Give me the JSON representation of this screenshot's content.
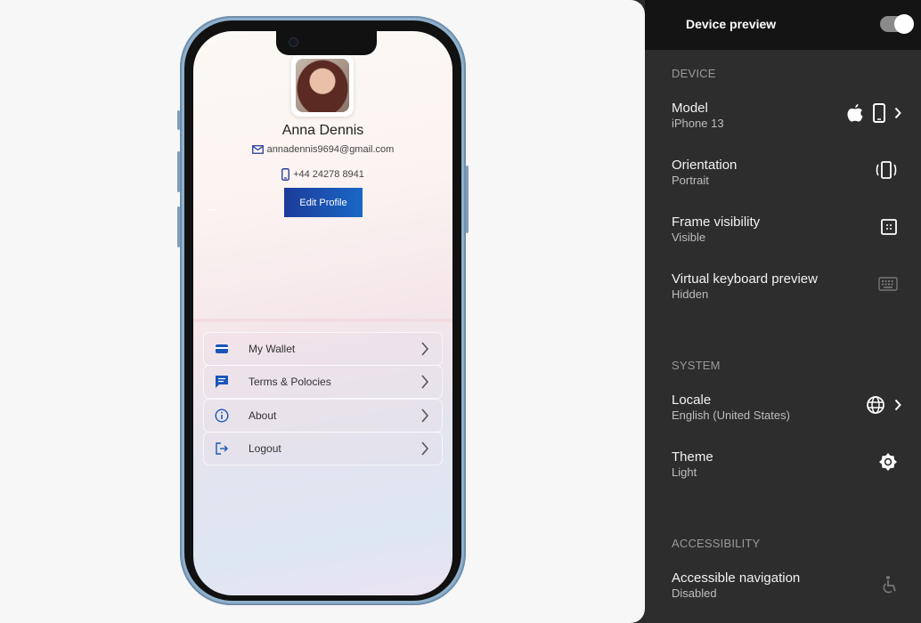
{
  "profile": {
    "name": "Anna Dennis",
    "email": "annadennis9694@gmail.com",
    "phone": "+44 24278 8941",
    "edit_label": "Edit Profile"
  },
  "menu": [
    {
      "label": "My Wallet",
      "icon": "wallet-icon"
    },
    {
      "label": "Terms & Polocies",
      "icon": "chat-icon"
    },
    {
      "label": "About",
      "icon": "info-icon"
    },
    {
      "label": "Logout",
      "icon": "logout-icon"
    }
  ],
  "panel": {
    "title": "Device preview",
    "toggle_on": true,
    "sections": {
      "device": "DEVICE",
      "system": "SYSTEM",
      "accessibility": "ACCESSIBILITY"
    },
    "model": {
      "title": "Model",
      "value": "iPhone 13"
    },
    "orientation": {
      "title": "Orientation",
      "value": "Portrait"
    },
    "frame": {
      "title": "Frame visibility",
      "value": "Visible"
    },
    "keyboard": {
      "title": "Virtual keyboard preview",
      "value": "Hidden"
    },
    "locale": {
      "title": "Locale",
      "value": "English (United States)"
    },
    "theme": {
      "title": "Theme",
      "value": "Light"
    },
    "accessible_nav": {
      "title": "Accessible navigation",
      "value": "Disabled"
    }
  },
  "colors": {
    "accent": "#1a56b8",
    "panel_bg": "#2d2d2d",
    "header_bg": "#141414"
  }
}
